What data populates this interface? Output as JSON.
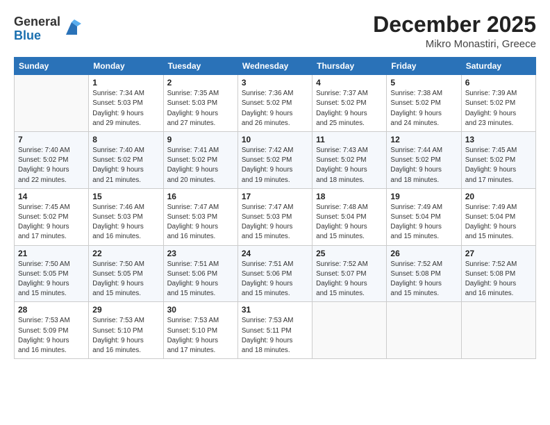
{
  "header": {
    "logo_general": "General",
    "logo_blue": "Blue",
    "month": "December 2025",
    "location": "Mikro Monastiri, Greece"
  },
  "weekdays": [
    "Sunday",
    "Monday",
    "Tuesday",
    "Wednesday",
    "Thursday",
    "Friday",
    "Saturday"
  ],
  "weeks": [
    [
      {
        "day": "",
        "info": ""
      },
      {
        "day": "1",
        "info": "Sunrise: 7:34 AM\nSunset: 5:03 PM\nDaylight: 9 hours\nand 29 minutes."
      },
      {
        "day": "2",
        "info": "Sunrise: 7:35 AM\nSunset: 5:03 PM\nDaylight: 9 hours\nand 27 minutes."
      },
      {
        "day": "3",
        "info": "Sunrise: 7:36 AM\nSunset: 5:02 PM\nDaylight: 9 hours\nand 26 minutes."
      },
      {
        "day": "4",
        "info": "Sunrise: 7:37 AM\nSunset: 5:02 PM\nDaylight: 9 hours\nand 25 minutes."
      },
      {
        "day": "5",
        "info": "Sunrise: 7:38 AM\nSunset: 5:02 PM\nDaylight: 9 hours\nand 24 minutes."
      },
      {
        "day": "6",
        "info": "Sunrise: 7:39 AM\nSunset: 5:02 PM\nDaylight: 9 hours\nand 23 minutes."
      }
    ],
    [
      {
        "day": "7",
        "info": "Sunrise: 7:40 AM\nSunset: 5:02 PM\nDaylight: 9 hours\nand 22 minutes."
      },
      {
        "day": "8",
        "info": "Sunrise: 7:40 AM\nSunset: 5:02 PM\nDaylight: 9 hours\nand 21 minutes."
      },
      {
        "day": "9",
        "info": "Sunrise: 7:41 AM\nSunset: 5:02 PM\nDaylight: 9 hours\nand 20 minutes."
      },
      {
        "day": "10",
        "info": "Sunrise: 7:42 AM\nSunset: 5:02 PM\nDaylight: 9 hours\nand 19 minutes."
      },
      {
        "day": "11",
        "info": "Sunrise: 7:43 AM\nSunset: 5:02 PM\nDaylight: 9 hours\nand 18 minutes."
      },
      {
        "day": "12",
        "info": "Sunrise: 7:44 AM\nSunset: 5:02 PM\nDaylight: 9 hours\nand 18 minutes."
      },
      {
        "day": "13",
        "info": "Sunrise: 7:45 AM\nSunset: 5:02 PM\nDaylight: 9 hours\nand 17 minutes."
      }
    ],
    [
      {
        "day": "14",
        "info": "Sunrise: 7:45 AM\nSunset: 5:02 PM\nDaylight: 9 hours\nand 17 minutes."
      },
      {
        "day": "15",
        "info": "Sunrise: 7:46 AM\nSunset: 5:03 PM\nDaylight: 9 hours\nand 16 minutes."
      },
      {
        "day": "16",
        "info": "Sunrise: 7:47 AM\nSunset: 5:03 PM\nDaylight: 9 hours\nand 16 minutes."
      },
      {
        "day": "17",
        "info": "Sunrise: 7:47 AM\nSunset: 5:03 PM\nDaylight: 9 hours\nand 15 minutes."
      },
      {
        "day": "18",
        "info": "Sunrise: 7:48 AM\nSunset: 5:04 PM\nDaylight: 9 hours\nand 15 minutes."
      },
      {
        "day": "19",
        "info": "Sunrise: 7:49 AM\nSunset: 5:04 PM\nDaylight: 9 hours\nand 15 minutes."
      },
      {
        "day": "20",
        "info": "Sunrise: 7:49 AM\nSunset: 5:04 PM\nDaylight: 9 hours\nand 15 minutes."
      }
    ],
    [
      {
        "day": "21",
        "info": "Sunrise: 7:50 AM\nSunset: 5:05 PM\nDaylight: 9 hours\nand 15 minutes."
      },
      {
        "day": "22",
        "info": "Sunrise: 7:50 AM\nSunset: 5:05 PM\nDaylight: 9 hours\nand 15 minutes."
      },
      {
        "day": "23",
        "info": "Sunrise: 7:51 AM\nSunset: 5:06 PM\nDaylight: 9 hours\nand 15 minutes."
      },
      {
        "day": "24",
        "info": "Sunrise: 7:51 AM\nSunset: 5:06 PM\nDaylight: 9 hours\nand 15 minutes."
      },
      {
        "day": "25",
        "info": "Sunrise: 7:52 AM\nSunset: 5:07 PM\nDaylight: 9 hours\nand 15 minutes."
      },
      {
        "day": "26",
        "info": "Sunrise: 7:52 AM\nSunset: 5:08 PM\nDaylight: 9 hours\nand 15 minutes."
      },
      {
        "day": "27",
        "info": "Sunrise: 7:52 AM\nSunset: 5:08 PM\nDaylight: 9 hours\nand 16 minutes."
      }
    ],
    [
      {
        "day": "28",
        "info": "Sunrise: 7:53 AM\nSunset: 5:09 PM\nDaylight: 9 hours\nand 16 minutes."
      },
      {
        "day": "29",
        "info": "Sunrise: 7:53 AM\nSunset: 5:10 PM\nDaylight: 9 hours\nand 16 minutes."
      },
      {
        "day": "30",
        "info": "Sunrise: 7:53 AM\nSunset: 5:10 PM\nDaylight: 9 hours\nand 17 minutes."
      },
      {
        "day": "31",
        "info": "Sunrise: 7:53 AM\nSunset: 5:11 PM\nDaylight: 9 hours\nand 18 minutes."
      },
      {
        "day": "",
        "info": ""
      },
      {
        "day": "",
        "info": ""
      },
      {
        "day": "",
        "info": ""
      }
    ]
  ]
}
